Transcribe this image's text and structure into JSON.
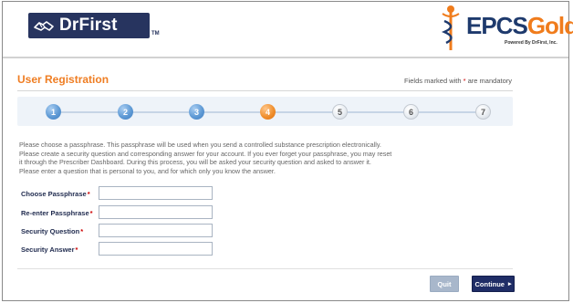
{
  "header": {
    "left_logo": "DrFirst",
    "left_logo_tm": "TM",
    "right_logo_part1": "EPCS",
    "right_logo_part2": "Gold",
    "right_logo_tagline": "Powered By DrFirst, Inc."
  },
  "page": {
    "title": "User Registration",
    "mandatory_prefix": "Fields marked with ",
    "mandatory_star": "*",
    "mandatory_suffix": " are mandatory"
  },
  "steps": [
    {
      "label": "1",
      "state": "done"
    },
    {
      "label": "2",
      "state": "done"
    },
    {
      "label": "3",
      "state": "done"
    },
    {
      "label": "4",
      "state": "current"
    },
    {
      "label": "5",
      "state": "todo"
    },
    {
      "label": "6",
      "state": "todo"
    },
    {
      "label": "7",
      "state": "todo"
    }
  ],
  "description": [
    "Please choose a passphrase. This passphrase will be used when you send a controlled substance prescription electronically.",
    "Please create a security question and corresponding answer for your account. If you ever forget your passphrase, you may reset",
    "it through the Prescriber Dashboard. During this process, you will be asked your security question and asked to answer it.",
    "Please enter a question that is personal to you, and for which only you know the answer."
  ],
  "form": {
    "passphrase_label": "Choose Passphrase",
    "passphrase_value": "",
    "reenter_label": "Re-enter Passphrase",
    "reenter_value": "",
    "question_label": "Security Question",
    "question_value": "",
    "answer_label": "Security Answer",
    "answer_value": "",
    "required_star": "*"
  },
  "buttons": {
    "quit": "Quit",
    "continue": "Continue",
    "continue_arrow": "▸"
  },
  "colors": {
    "accent_orange": "#ef7d22",
    "brand_navy": "#1f2d66",
    "step_done": "#5f9ad5",
    "step_current": "#f0902f"
  }
}
